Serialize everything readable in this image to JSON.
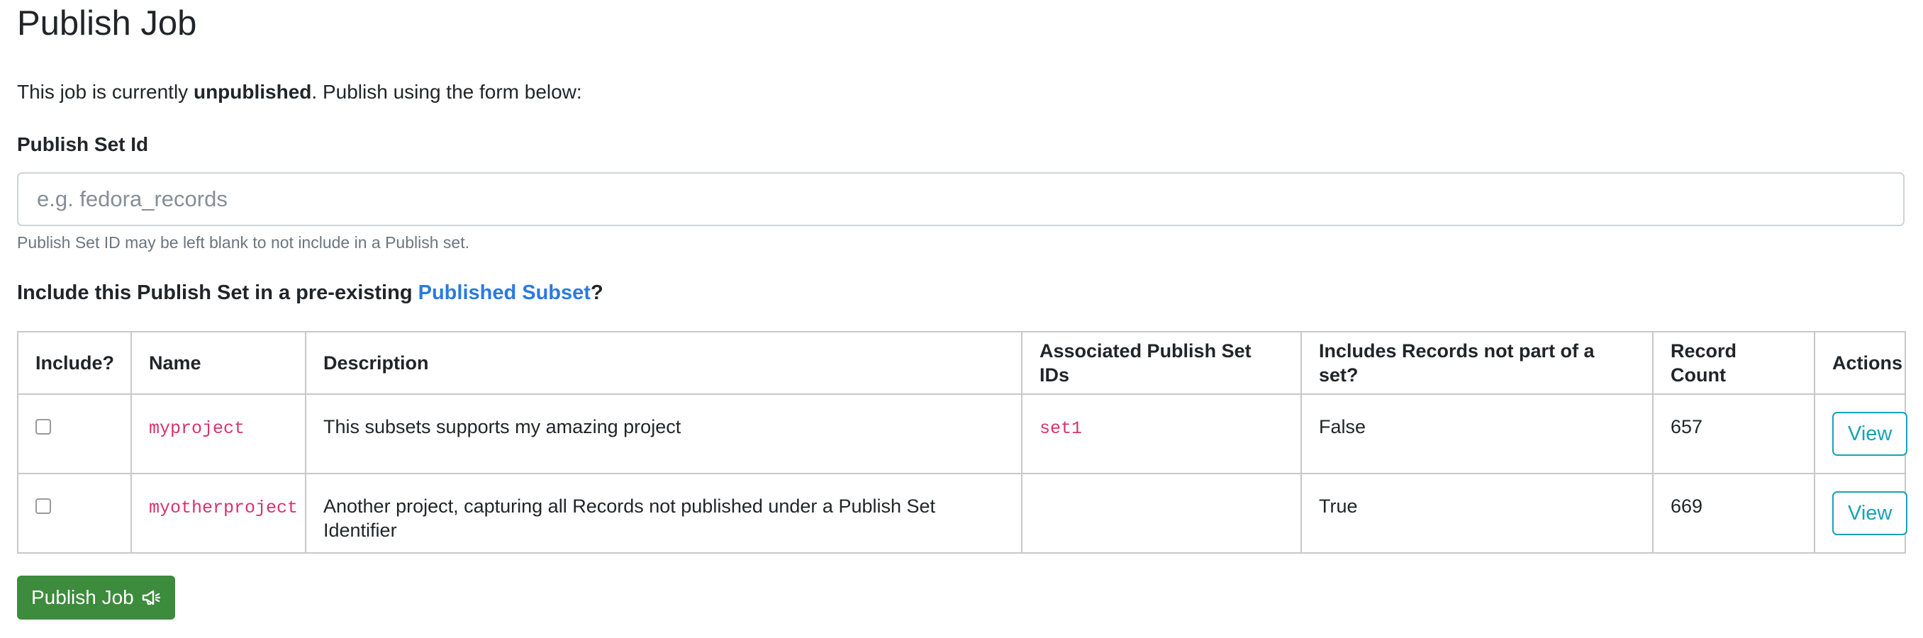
{
  "page": {
    "title": "Publish Job"
  },
  "status": {
    "prefix": "This job is currently ",
    "state": "unpublished",
    "suffix": ". Publish using the form below:"
  },
  "publish_set": {
    "label": "Publish Set Id",
    "value": "",
    "placeholder": "e.g. fedora_records",
    "help": "Publish Set ID may be left blank to not include in a Publish set."
  },
  "subset_prompt": {
    "prefix": "Include this Publish Set in a pre-existing ",
    "link": "Published Subset",
    "suffix": "?"
  },
  "table": {
    "headers": {
      "include": "Include?",
      "name": "Name",
      "description": "Description",
      "associated": "Associated Publish Set IDs",
      "includes_records": "Includes Records not part of a set?",
      "record_count": "Record Count",
      "actions": "Actions"
    },
    "rows": [
      {
        "include": false,
        "name": "myproject",
        "description": "This subsets supports my amazing project",
        "associated": "set1",
        "includes_records": "False",
        "record_count": "657",
        "action": "View"
      },
      {
        "include": false,
        "name": "myotherproject",
        "description": "Another project, capturing all Records not published under a Publish Set Identifier",
        "associated": "",
        "includes_records": "True",
        "record_count": "669",
        "action": "View"
      }
    ]
  },
  "actions": {
    "publish_label": "Publish Job",
    "publish_icon": "megaphone-icon"
  },
  "colors": {
    "link": "#2a7ae2",
    "code": "#d6336c",
    "view_button": "#17a2b8",
    "publish_button": "#3d8b3d"
  }
}
